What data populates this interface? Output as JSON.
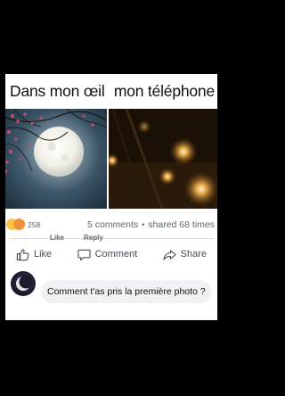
{
  "caption": {
    "left": "Dans mon œil",
    "right": "mon téléphone"
  },
  "stats": {
    "reaction_count": "258",
    "comments": "5 comments",
    "separator": "•",
    "shares": "shared 68 times"
  },
  "actions": {
    "like": "Like",
    "comment": "Comment",
    "share": "Share"
  },
  "comment": {
    "author": "",
    "text": "Comment t'as pris la première photo ?",
    "like": "Like",
    "reply": "Reply"
  },
  "colors": {
    "card_bg": "#ffffff",
    "page_bg": "#000000",
    "muted_text": "#606770",
    "bubble_bg": "#f0f2f5"
  }
}
